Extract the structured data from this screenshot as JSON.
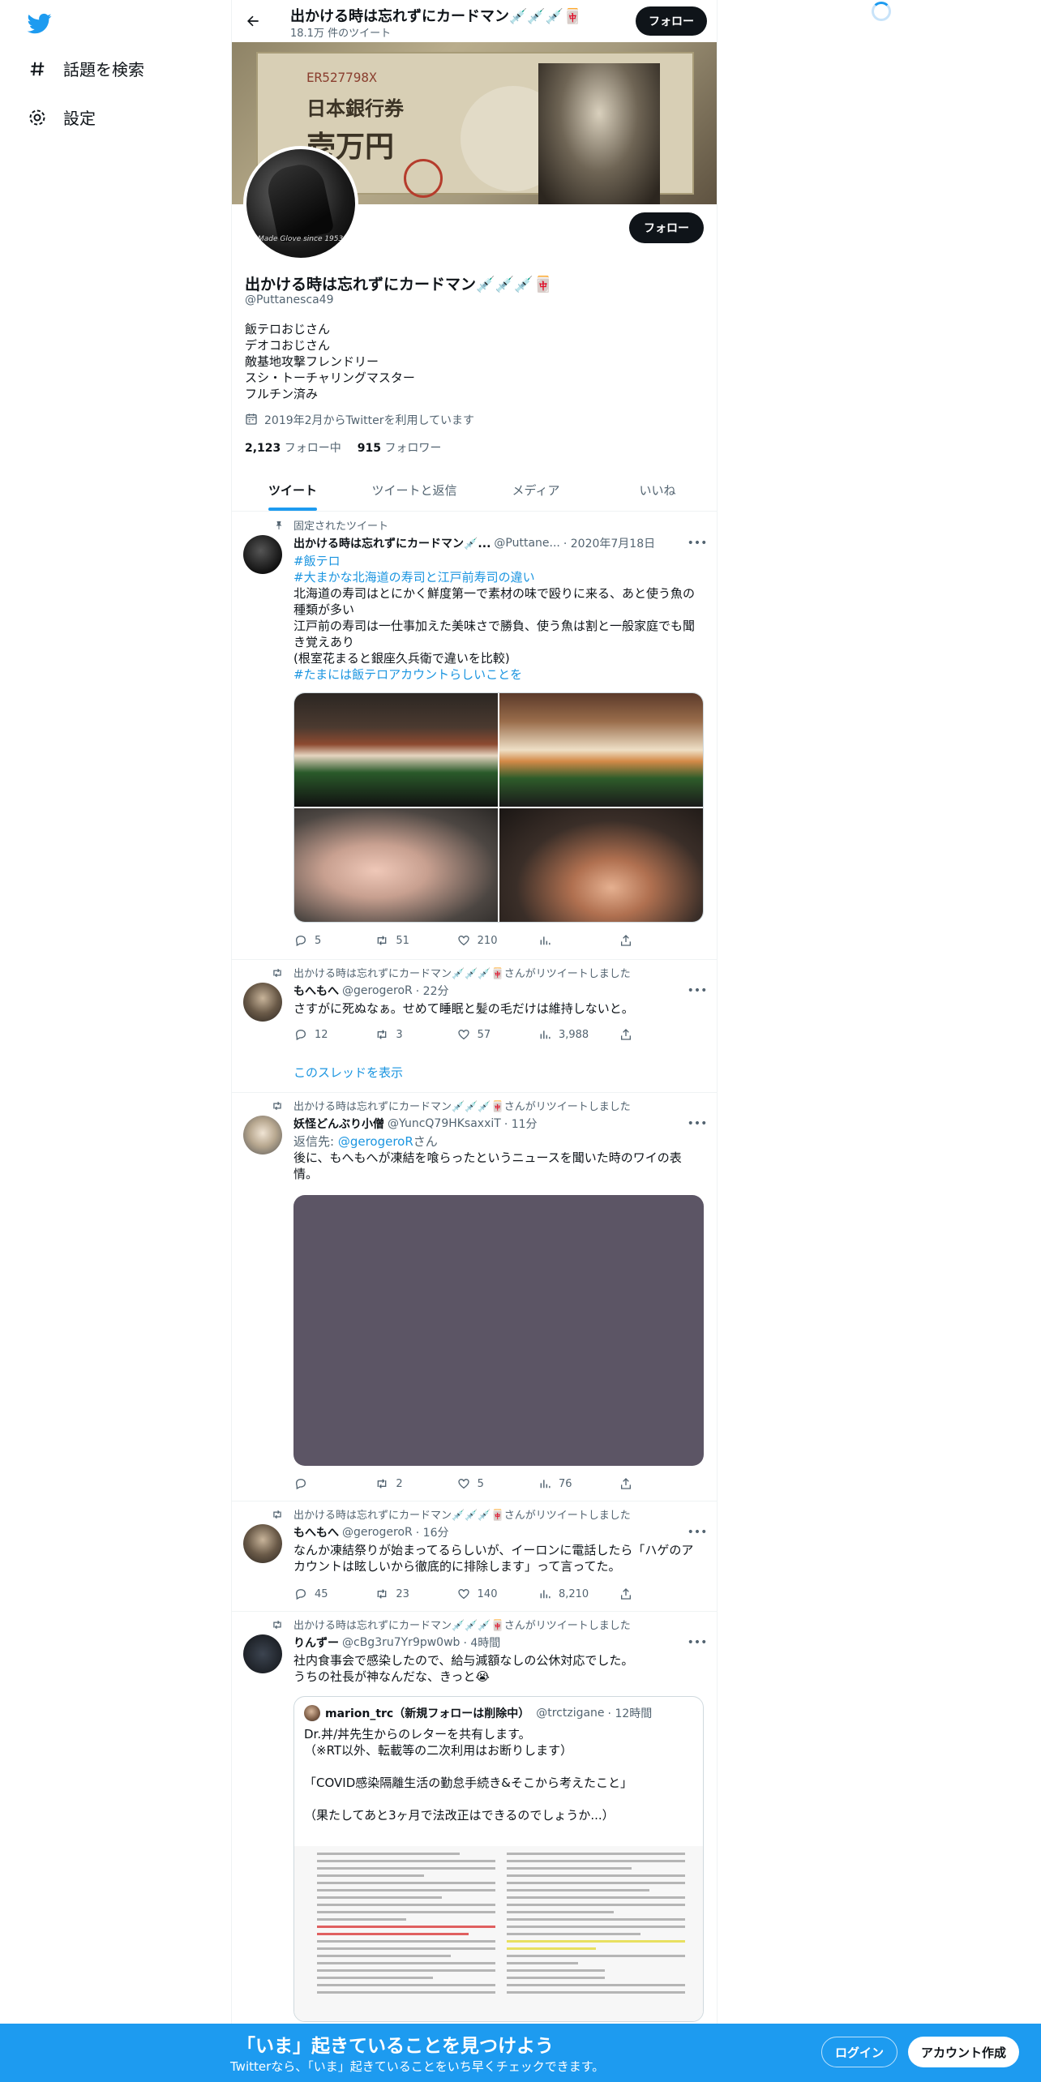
{
  "nav": {
    "items": [
      {
        "label": "話題を検索",
        "icon": "hashtag-icon"
      },
      {
        "label": "設定",
        "icon": "gear-icon"
      }
    ]
  },
  "topbar": {
    "name": "出かける時は忘れずにカードマン💉💉💉🀄",
    "tweet_count": "18.1万 件のツイート",
    "follow_label": "フォロー"
  },
  "banner": {
    "serial": "ER527798X",
    "text1": "日本銀行券",
    "text2": "壱万円"
  },
  "profile": {
    "name": "出かける時は忘れずにカードマン💉💉💉🀄",
    "handle": "@Puttanesca49",
    "follow_label": "フォロー",
    "avatar_script": "Made Glove since 1953",
    "bio": [
      "飯テロおじさん",
      "デオコおじさん",
      "敵基地攻撃フレンドリー",
      "スシ・トーチャリングマスター",
      "フルチン済み"
    ],
    "joined": "2019年2月からTwitterを利用しています",
    "following_count": "2,123",
    "following_label": "フォロー中",
    "followers_count": "915",
    "followers_label": "フォロワー"
  },
  "tabs": [
    {
      "label": "ツイート",
      "active": true
    },
    {
      "label": "ツイートと返信",
      "active": false
    },
    {
      "label": "メディア",
      "active": false
    },
    {
      "label": "いいね",
      "active": false
    }
  ],
  "tweets": [
    {
      "context": "固定されたツイート",
      "name": "出かける時は忘れずにカードマン💉...",
      "handle": "@Puttane...",
      "time": "· 2020年7月18日",
      "lines": [
        {
          "text": "#飯テロ",
          "link": true
        },
        {
          "text": "#大まかな北海道の寿司と江戸前寿司の違い",
          "link": true
        },
        {
          "text": "北海道の寿司はとにかく鮮度第一で素材の味で殴りに来る、あと使う魚の種類が多い",
          "link": false
        },
        {
          "text": "江戸前の寿司は一仕事加えた美味さで勝負、使う魚は割と一般家庭でも聞き覚えあり",
          "link": false
        },
        {
          "text": "(根室花まると銀座久兵衛で違いを比較)",
          "link": false
        },
        {
          "text": "#たまには飯テロアカウントらしいことを",
          "link": true
        }
      ],
      "replies": "5",
      "retweets": "51",
      "likes": "210",
      "views": ""
    },
    {
      "context": "出かける時は忘れずにカードマン💉💉💉🀄さんがリツイートしました",
      "name": "もへもへ",
      "handle": "@gerogeroR",
      "time": "· 22分",
      "lines": [
        {
          "text": "さすがに死ぬなぁ。せめて睡眠と髪の毛だけは維持しないと。",
          "link": false
        }
      ],
      "replies": "12",
      "retweets": "3",
      "likes": "57",
      "views": "3,988",
      "show_thread": "このスレッドを表示"
    },
    {
      "context": "出かける時は忘れずにカードマン💉💉💉🀄さんがリツイートしました",
      "name": "妖怪どんぶり小僧",
      "handle": "@YuncQ79HKsaxxiT",
      "time": "· 11分",
      "reply_to_prefix": "返信先: ",
      "reply_to_handle": "@gerogeroR",
      "reply_to_suffix": "さん",
      "lines": [
        {
          "text": "後に、もへもへが凍結を喰らったというニュースを聞いた時のワイの表情。",
          "link": false
        }
      ],
      "replies": "",
      "retweets": "2",
      "likes": "5",
      "views": "76"
    },
    {
      "context": "出かける時は忘れずにカードマン💉💉💉🀄さんがリツイートしました",
      "name": "もへもへ",
      "handle": "@gerogeroR",
      "time": "· 16分",
      "lines": [
        {
          "text": "なんか凍結祭りが始まってるらしいが、イーロンに電話したら「ハゲのアカウントは眩しいから徹底的に排除します」って言ってた。",
          "link": false
        }
      ],
      "replies": "45",
      "retweets": "23",
      "likes": "140",
      "views": "8,210"
    },
    {
      "context": "出かける時は忘れずにカードマン💉💉💉🀄さんがリツイートしました",
      "name": "りんずー",
      "handle": "@cBg3ru7Yr9pw0wb",
      "time": "· 4時間",
      "lines": [
        {
          "text": "社内食事会で感染したので、給与減額なしの公休対応でした。",
          "link": false
        },
        {
          "text": "うちの社長が神なんだな、きっと😭",
          "link": false
        }
      ],
      "quote": {
        "name": "marion_trc（新規フォローは削除中）",
        "handle": "@trctzigane",
        "time": "· 12時間",
        "lines": [
          "Dr.丼/丼先生からのレターを共有します。",
          "（※RT以外、転載等の二次利用はお断りします）",
          "",
          "「COVID感染隔離生活の勤怠手続き&そこから考えたこと」",
          "",
          "（果たしてあと3ヶ月で法改正はできるのでしょうか...）"
        ]
      }
    }
  ],
  "bottom_bar": {
    "title": "「いま」起きていることを見つけよう",
    "subtitle": "Twitterなら、「いま」起きていることをいち早くチェックできます。",
    "login_label": "ログイン",
    "signup_label": "アカウント作成"
  },
  "colors": {
    "accent": "#1d9bf0",
    "link": "#1b95e0",
    "text_secondary": "#536471"
  }
}
